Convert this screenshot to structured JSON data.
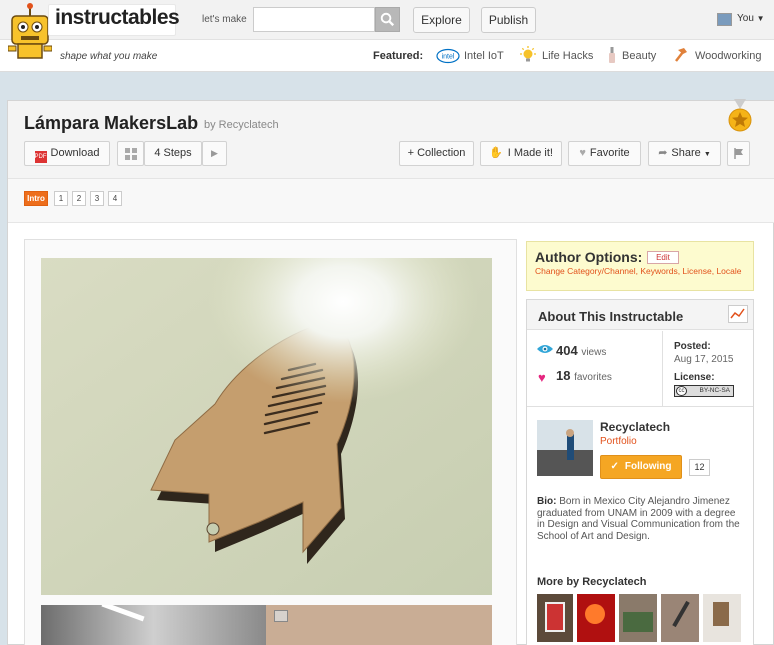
{
  "header": {
    "logo": "instructables",
    "tagline": "shape what you make",
    "lets_make": "let's make",
    "search_placeholder": "",
    "explore": "Explore",
    "publish": "Publish",
    "user": "You",
    "featured_label": "Featured:",
    "featured": [
      {
        "label": "Intel IoT",
        "icon": "intel-logo-icon"
      },
      {
        "label": "Life Hacks",
        "icon": "lightbulb-icon"
      },
      {
        "label": "Beauty",
        "icon": "nail-polish-icon"
      },
      {
        "label": "Woodworking",
        "icon": "hammer-icon"
      }
    ]
  },
  "page": {
    "title": "Lámpara MakersLab",
    "by": "by Recyclatech",
    "download": "Download",
    "steps": "4 Steps",
    "collection": "+ Collection",
    "imadeit": "I Made it!",
    "favorite": "Favorite",
    "share": "Share",
    "step_buttons": [
      "Intro",
      "1",
      "2",
      "3",
      "4"
    ]
  },
  "author_options": {
    "title": "Author Options:",
    "edit": "Edit",
    "links": "Change Category/Channel, Keywords, License, Locale"
  },
  "about": {
    "title": "About This Instructable",
    "views_count": "404",
    "views_label": "views",
    "favorites_count": "18",
    "favorites_label": "favorites",
    "posted_label": "Posted:",
    "posted_date": "Aug 17, 2015",
    "license_label": "License:",
    "license_badge": "BY-NC-SA",
    "author_name": "Recyclatech",
    "portfolio": "Portfolio",
    "following": "Following",
    "followers": "12",
    "bio_label": "Bio:",
    "bio": "Born in Mexico City Alejandro Jimenez graduated from UNAM in 2009 with a degree in Design and Visual Communication from the School of Art and Design.",
    "more_by": "More by Recyclatech"
  },
  "colors": {
    "accent": "#e2511b",
    "following": "#f5a623",
    "page_bg": "#d7e2e9"
  }
}
